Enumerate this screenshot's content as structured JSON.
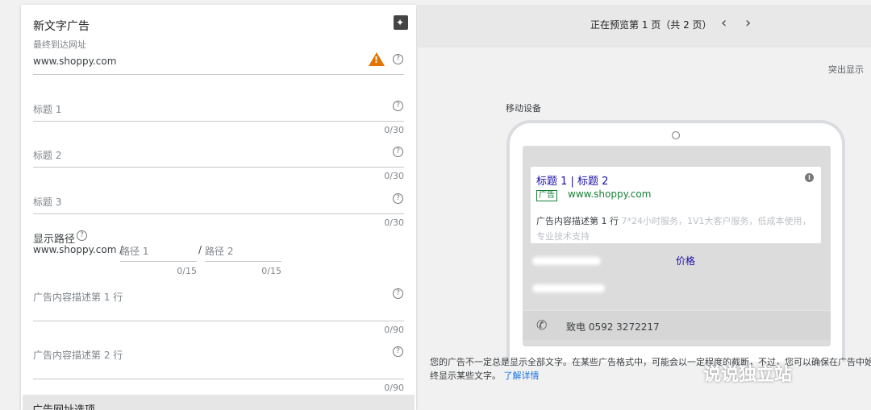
{
  "form": {
    "title": "新文字广告",
    "final_url_label": "最终到达网址",
    "final_url_value": "www.shoppy.com",
    "headline1_label": "标题 1",
    "headline1_count": "0/30",
    "headline2_label": "标题 2",
    "headline2_count": "0/30",
    "headline3_label": "标题 3",
    "headline3_count": "0/30",
    "display_path_label": "显示路径",
    "display_path_domain": "www.shoppy.com /",
    "path1_placeholder": "路径 1",
    "path1_count": "0/15",
    "path_sep": "/",
    "path2_placeholder": "路径 2",
    "path2_count": "0/15",
    "desc1_label": "广告内容描述第 1 行",
    "desc1_count": "0/90",
    "desc2_label": "广告内容描述第 2 行",
    "desc2_count": "0/90",
    "url_options_label": "广告网址选项"
  },
  "preview": {
    "page_indicator": "正在预览第 1 页（共 2 页）",
    "prev_icon": "chevron-left-icon",
    "next_icon": "chevron-right-icon",
    "prominent_label": "突出显示",
    "mobile_label": "移动设备",
    "ad": {
      "headline": "标题 1 | 标题 2",
      "badge": "广告",
      "url": "www.shoppy.com",
      "desc_line": "广告内容描述第 1 行",
      "desc_placeholder": "7*24小时服务，1V1大客户服务，低成本使用，专业技术支持",
      "sitelink2": "价格",
      "call_text": "致电 0592 3272217"
    },
    "note": "您的广告不一定总是显示全部文字。在某些广告格式中，可能会以一定程度的截断，不过，您可以确保在广告中始终显示某些文字。",
    "learn_more": "了解详情"
  },
  "watermark": "说说独立站",
  "colors": {
    "link": "#1a0dab",
    "green": "#188038",
    "warning": "#e37400",
    "accent": "#1a73e8"
  }
}
